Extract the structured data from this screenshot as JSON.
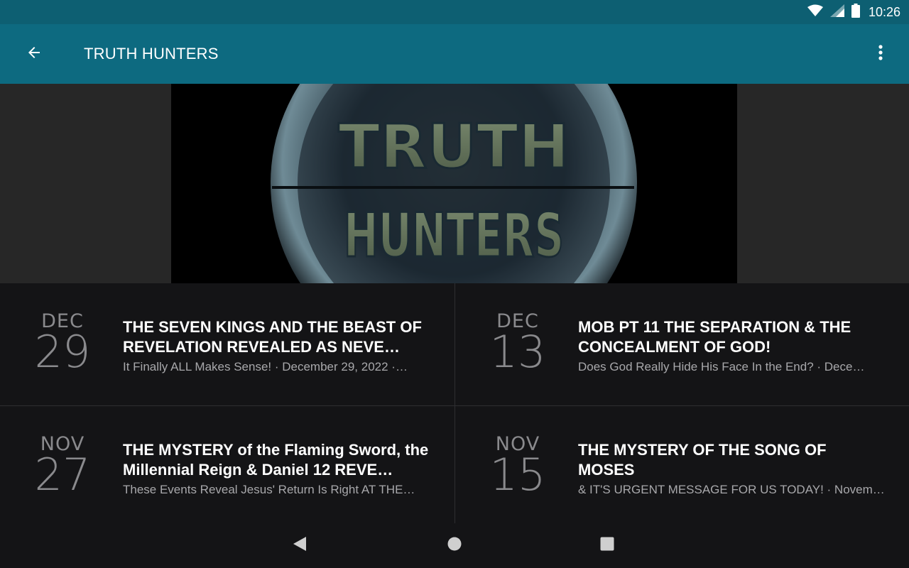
{
  "status_bar": {
    "time": "10:26"
  },
  "app_bar": {
    "title": "TRUTH HUNTERS"
  },
  "banner": {
    "line1": "TRUTH",
    "line2": "HUNTERS"
  },
  "episodes": [
    {
      "month": "DEC",
      "day": "29",
      "title": "THE SEVEN KINGS AND THE BEAST OF REVELATION REVEALED AS NEVE…",
      "subtitle": "It Finally ALL Makes Sense! · December 29, 2022 ·…"
    },
    {
      "month": "DEC",
      "day": "13",
      "title": "MOB PT 11 THE SEPARATION & THE CONCEALMENT OF GOD!",
      "subtitle": "Does God Really Hide His Face In the End? · Dece…"
    },
    {
      "month": "NOV",
      "day": "27",
      "title": "THE MYSTERY of the Flaming Sword, the Millennial Reign & Daniel 12 REVE…",
      "subtitle": "These Events Reveal Jesus' Return Is Right AT THE…"
    },
    {
      "month": "NOV",
      "day": "15",
      "title": "THE MYSTERY OF THE SONG OF MOSES",
      "subtitle": "& IT'S URGENT MESSAGE FOR US TODAY! · Novem…"
    }
  ],
  "icons": {
    "wifi": "wifi-icon",
    "signal": "signal-icon",
    "battery": "battery-icon",
    "back": "arrow-left-icon",
    "overflow": "more-vert-icon",
    "nav_back": "nav-back-icon",
    "nav_home": "nav-home-icon",
    "nav_recents": "nav-recents-icon"
  },
  "colors": {
    "app_bar": "#0d6a80",
    "status_bar": "#0d5f72",
    "background": "#141416"
  }
}
